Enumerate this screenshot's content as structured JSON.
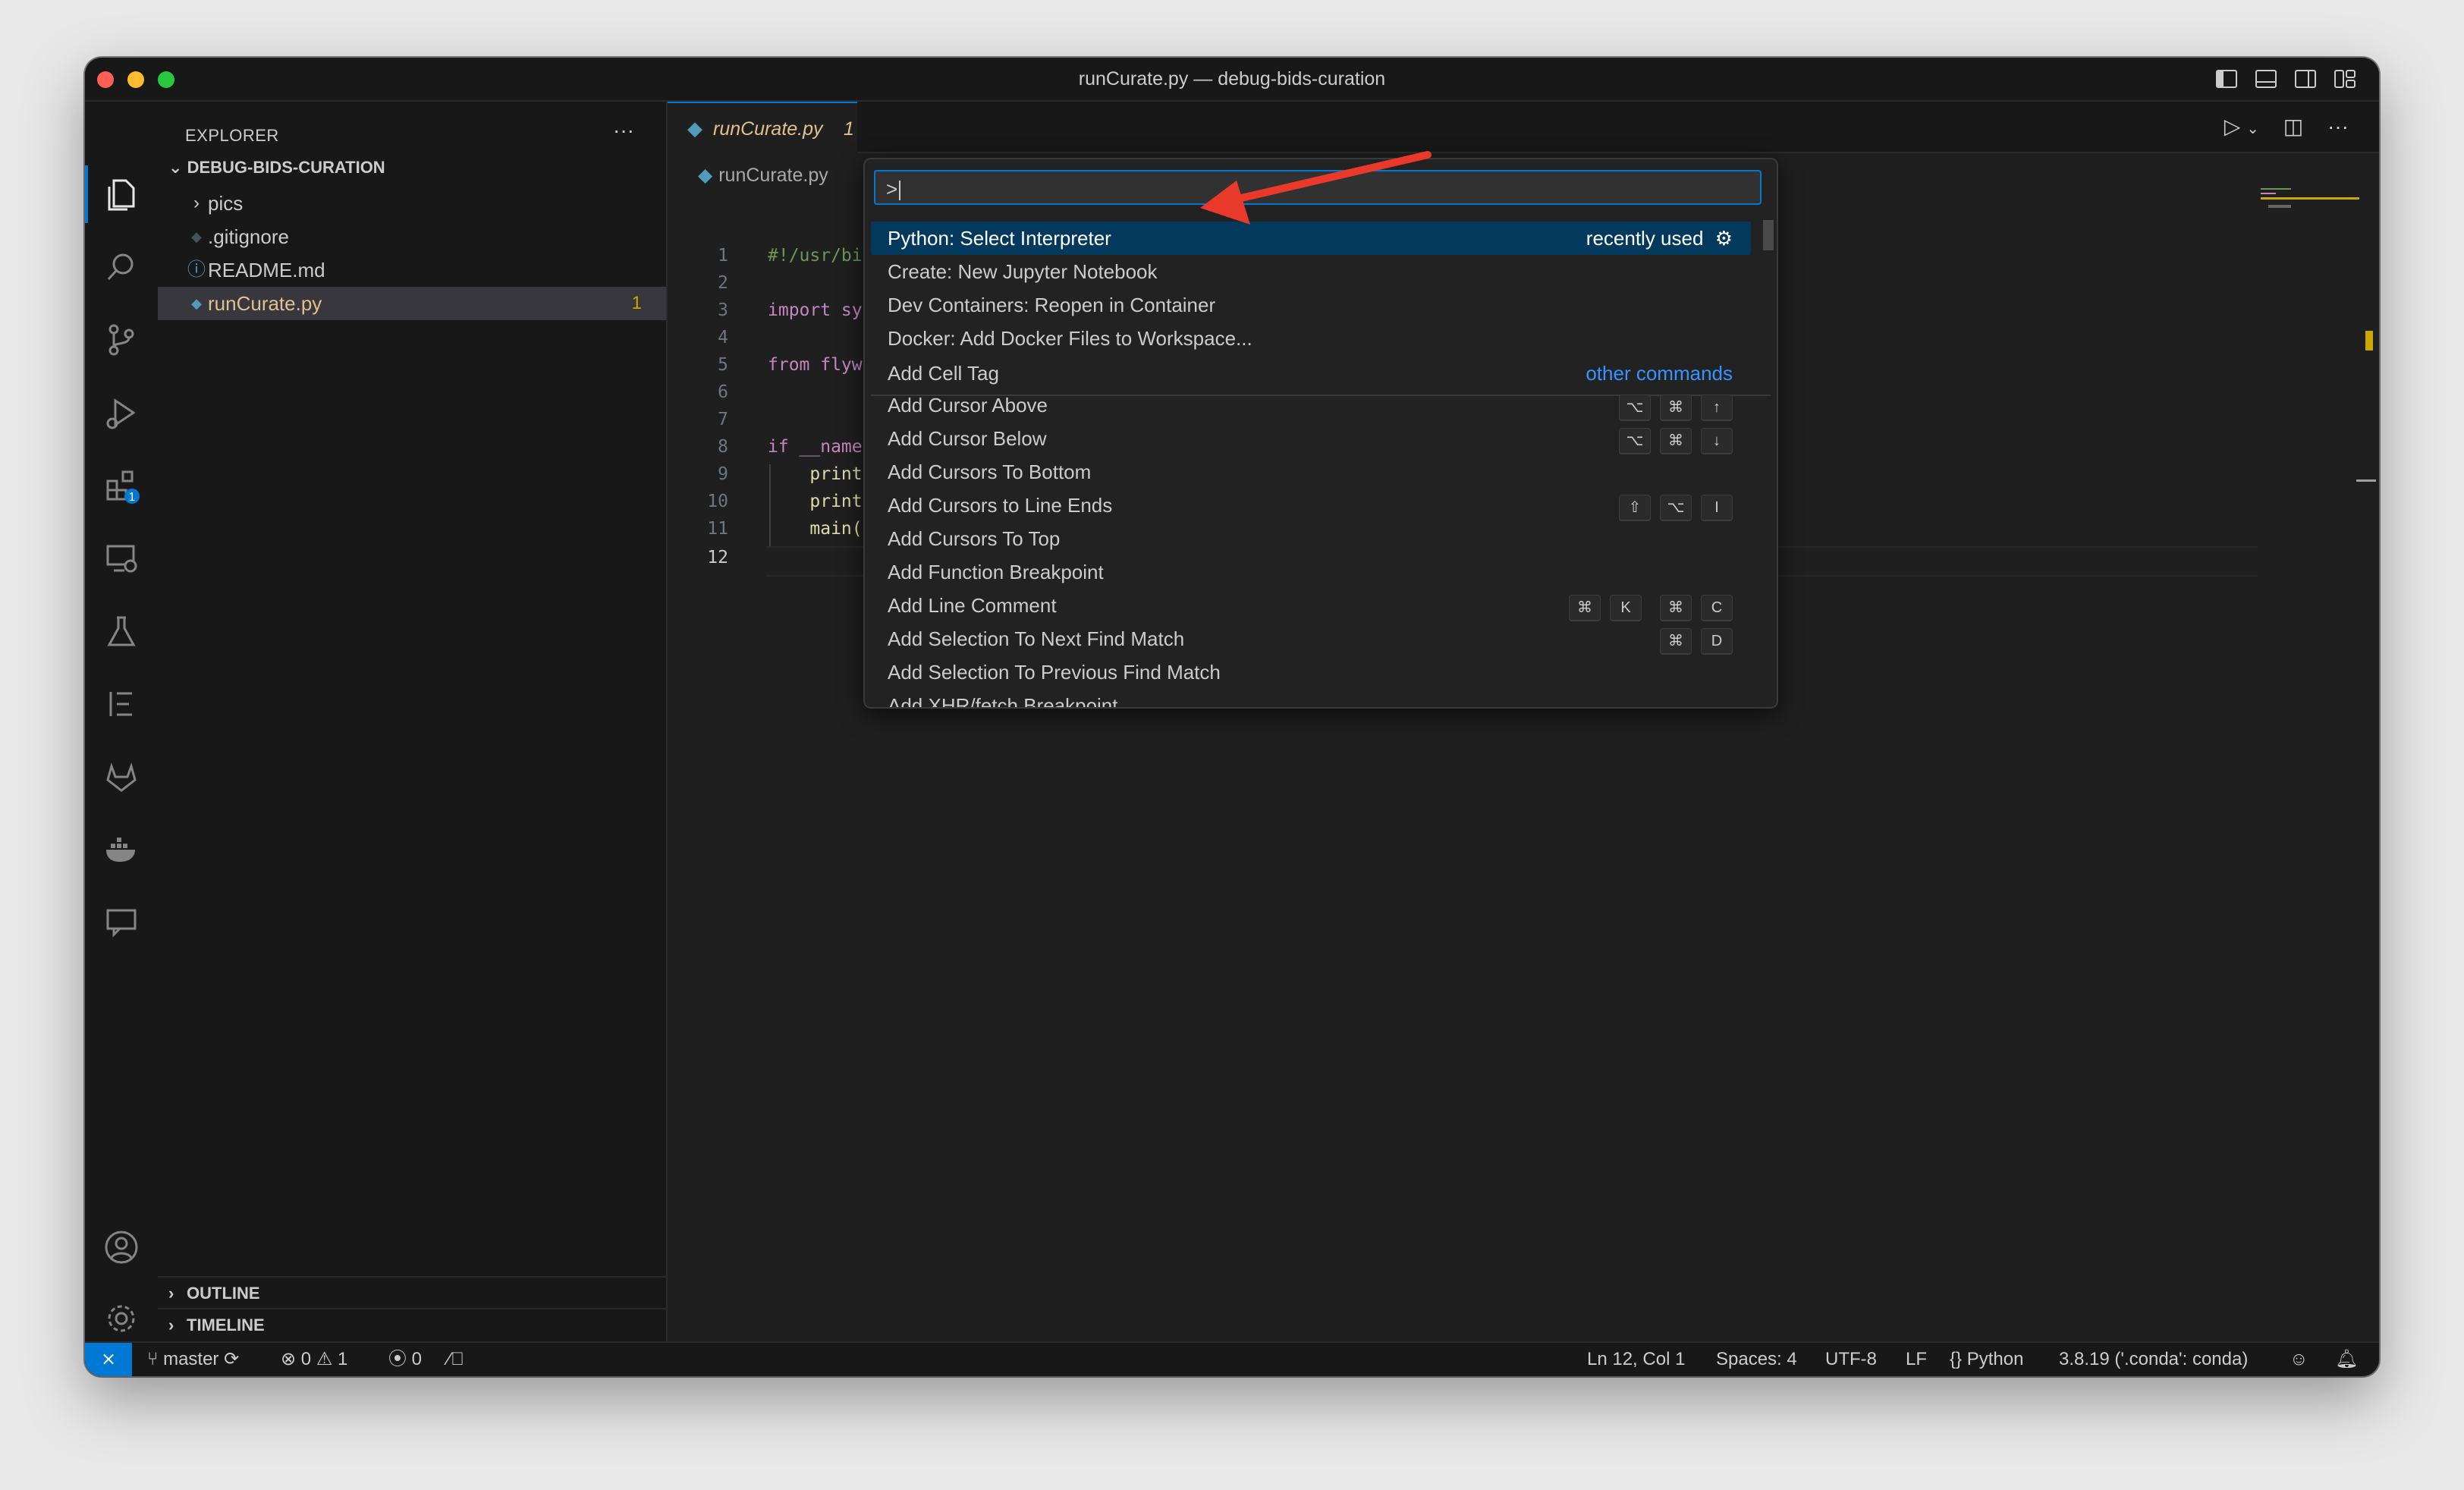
{
  "window": {
    "title": "runCurate.py — debug-bids-curation"
  },
  "activity": {
    "extensions_badge": "1"
  },
  "sidebar": {
    "title": "EXPLORER",
    "more": "···",
    "folder": "DEBUG-BIDS-CURATION",
    "items": [
      {
        "label": "pics",
        "icon": "chevron-right-icon",
        "glyph": "›"
      },
      {
        "label": ".gitignore",
        "icon": "git-icon",
        "glyph": "◆"
      },
      {
        "label": "README.md",
        "icon": "info-icon",
        "glyph": "ⓘ"
      },
      {
        "label": "runCurate.py",
        "icon": "python-icon",
        "glyph": "◆",
        "badge": "1"
      }
    ],
    "outline": "OUTLINE",
    "timeline": "TIMELINE"
  },
  "editor": {
    "tab_label": "runCurate.py",
    "tab_badge": "1",
    "breadcrumb": "runCurate.py",
    "lines": [
      {
        "n": "1",
        "text": "#!/usr/bi"
      },
      {
        "n": "2",
        "text": ""
      },
      {
        "n": "3",
        "text": "import sy"
      },
      {
        "n": "4",
        "text": ""
      },
      {
        "n": "5",
        "text": "from flyw"
      },
      {
        "n": "6",
        "text": ""
      },
      {
        "n": "7",
        "text": ""
      },
      {
        "n": "8",
        "text": "if __name"
      },
      {
        "n": "9",
        "text": "    print"
      },
      {
        "n": "10",
        "text": "    print"
      },
      {
        "n": "11",
        "text": "    main("
      },
      {
        "n": "12",
        "text": ""
      }
    ]
  },
  "palette": {
    "input_value": ">",
    "items": [
      {
        "label": "Python: Select Interpreter",
        "right": "recently used",
        "selected": true
      },
      {
        "label": "Create: New Jupyter Notebook"
      },
      {
        "label": "Dev Containers: Reopen in Container"
      },
      {
        "label": "Docker: Add Docker Files to Workspace..."
      },
      {
        "label": "Add Cell Tag",
        "right_link": "other commands"
      },
      {
        "label": "Add Cursor Above",
        "keys": [
          "⌥",
          "⌘",
          "↑"
        ]
      },
      {
        "label": "Add Cursor Below",
        "keys": [
          "⌥",
          "⌘",
          "↓"
        ]
      },
      {
        "label": "Add Cursors To Bottom"
      },
      {
        "label": "Add Cursors to Line Ends",
        "keys": [
          "⇧",
          "⌥",
          "I"
        ]
      },
      {
        "label": "Add Cursors To Top"
      },
      {
        "label": "Add Function Breakpoint"
      },
      {
        "label": "Add Line Comment",
        "keys": [
          "⌘",
          "K",
          "⌘",
          "C"
        ]
      },
      {
        "label": "Add Selection To Next Find Match",
        "keys": [
          "⌘",
          "D"
        ]
      },
      {
        "label": "Add Selection To Previous Find Match"
      },
      {
        "label": "Add XHR/fetch Breakpoint"
      }
    ]
  },
  "statusbar": {
    "branch": "master",
    "errors": "0",
    "warnings": "1",
    "ports": "0",
    "position": "Ln 12, Col 1",
    "spaces": "Spaces: 4",
    "encoding": "UTF-8",
    "eol": "LF",
    "language": "Python",
    "interpreter": "3.8.19 ('.conda': conda)"
  },
  "colors": {
    "accent": "#0078d4",
    "modified": "#e2c08d",
    "arrow": "#e8392b"
  }
}
